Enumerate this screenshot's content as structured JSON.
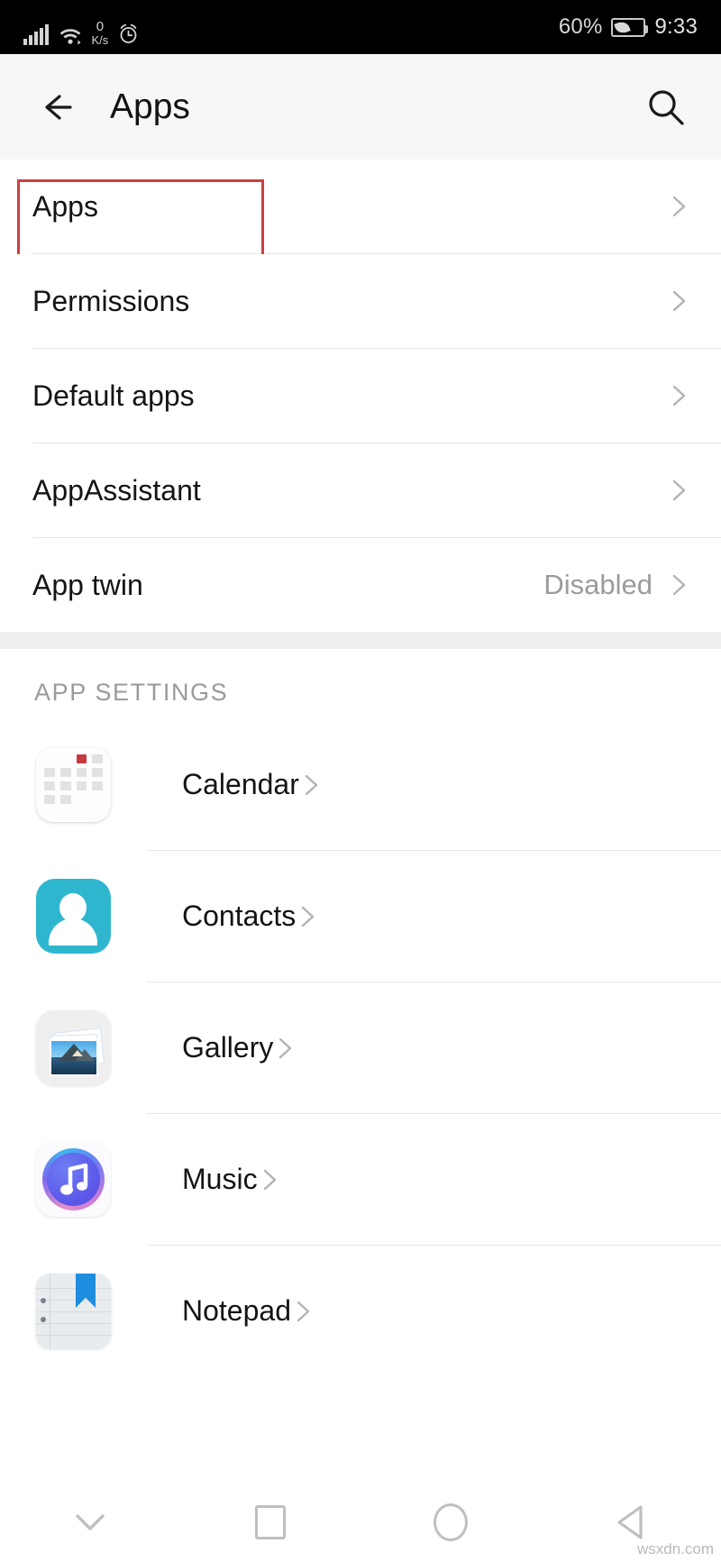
{
  "statusbar": {
    "network_speed_value": "0",
    "network_speed_unit": "K/s",
    "battery_percent": "60%",
    "time": "9:33",
    "icons": [
      "signal-icon",
      "wifi-icon",
      "alarm-icon",
      "battery-icon"
    ]
  },
  "appbar": {
    "title": "Apps",
    "back_icon": "back-arrow-icon",
    "search_icon": "search-icon"
  },
  "settings_rows": [
    {
      "label": "Apps",
      "value": "",
      "highlighted": true
    },
    {
      "label": "Permissions",
      "value": "",
      "highlighted": false
    },
    {
      "label": "Default apps",
      "value": "",
      "highlighted": false
    },
    {
      "label": "AppAssistant",
      "value": "",
      "highlighted": false
    },
    {
      "label": "App twin",
      "value": "Disabled",
      "highlighted": false
    }
  ],
  "app_settings": {
    "section_title": "APP SETTINGS",
    "items": [
      {
        "label": "Calendar",
        "icon": "calendar-icon"
      },
      {
        "label": "Contacts",
        "icon": "contacts-icon"
      },
      {
        "label": "Gallery",
        "icon": "gallery-icon"
      },
      {
        "label": "Music",
        "icon": "music-icon"
      },
      {
        "label": "Notepad",
        "icon": "notepad-icon"
      }
    ]
  },
  "navbar": {
    "buttons": [
      "chevron-down-icon",
      "recents-square-icon",
      "home-circle-icon",
      "back-triangle-icon"
    ]
  },
  "watermark": "wsxdn.com",
  "colors": {
    "highlight_box": "#c9403f",
    "calendar_red": "#c6393f",
    "contacts_teal": "#2fb6cf",
    "notepad_blue": "#1f8ddd",
    "appbar_bg": "#f7f7f7",
    "section_gap": "#efefef"
  }
}
